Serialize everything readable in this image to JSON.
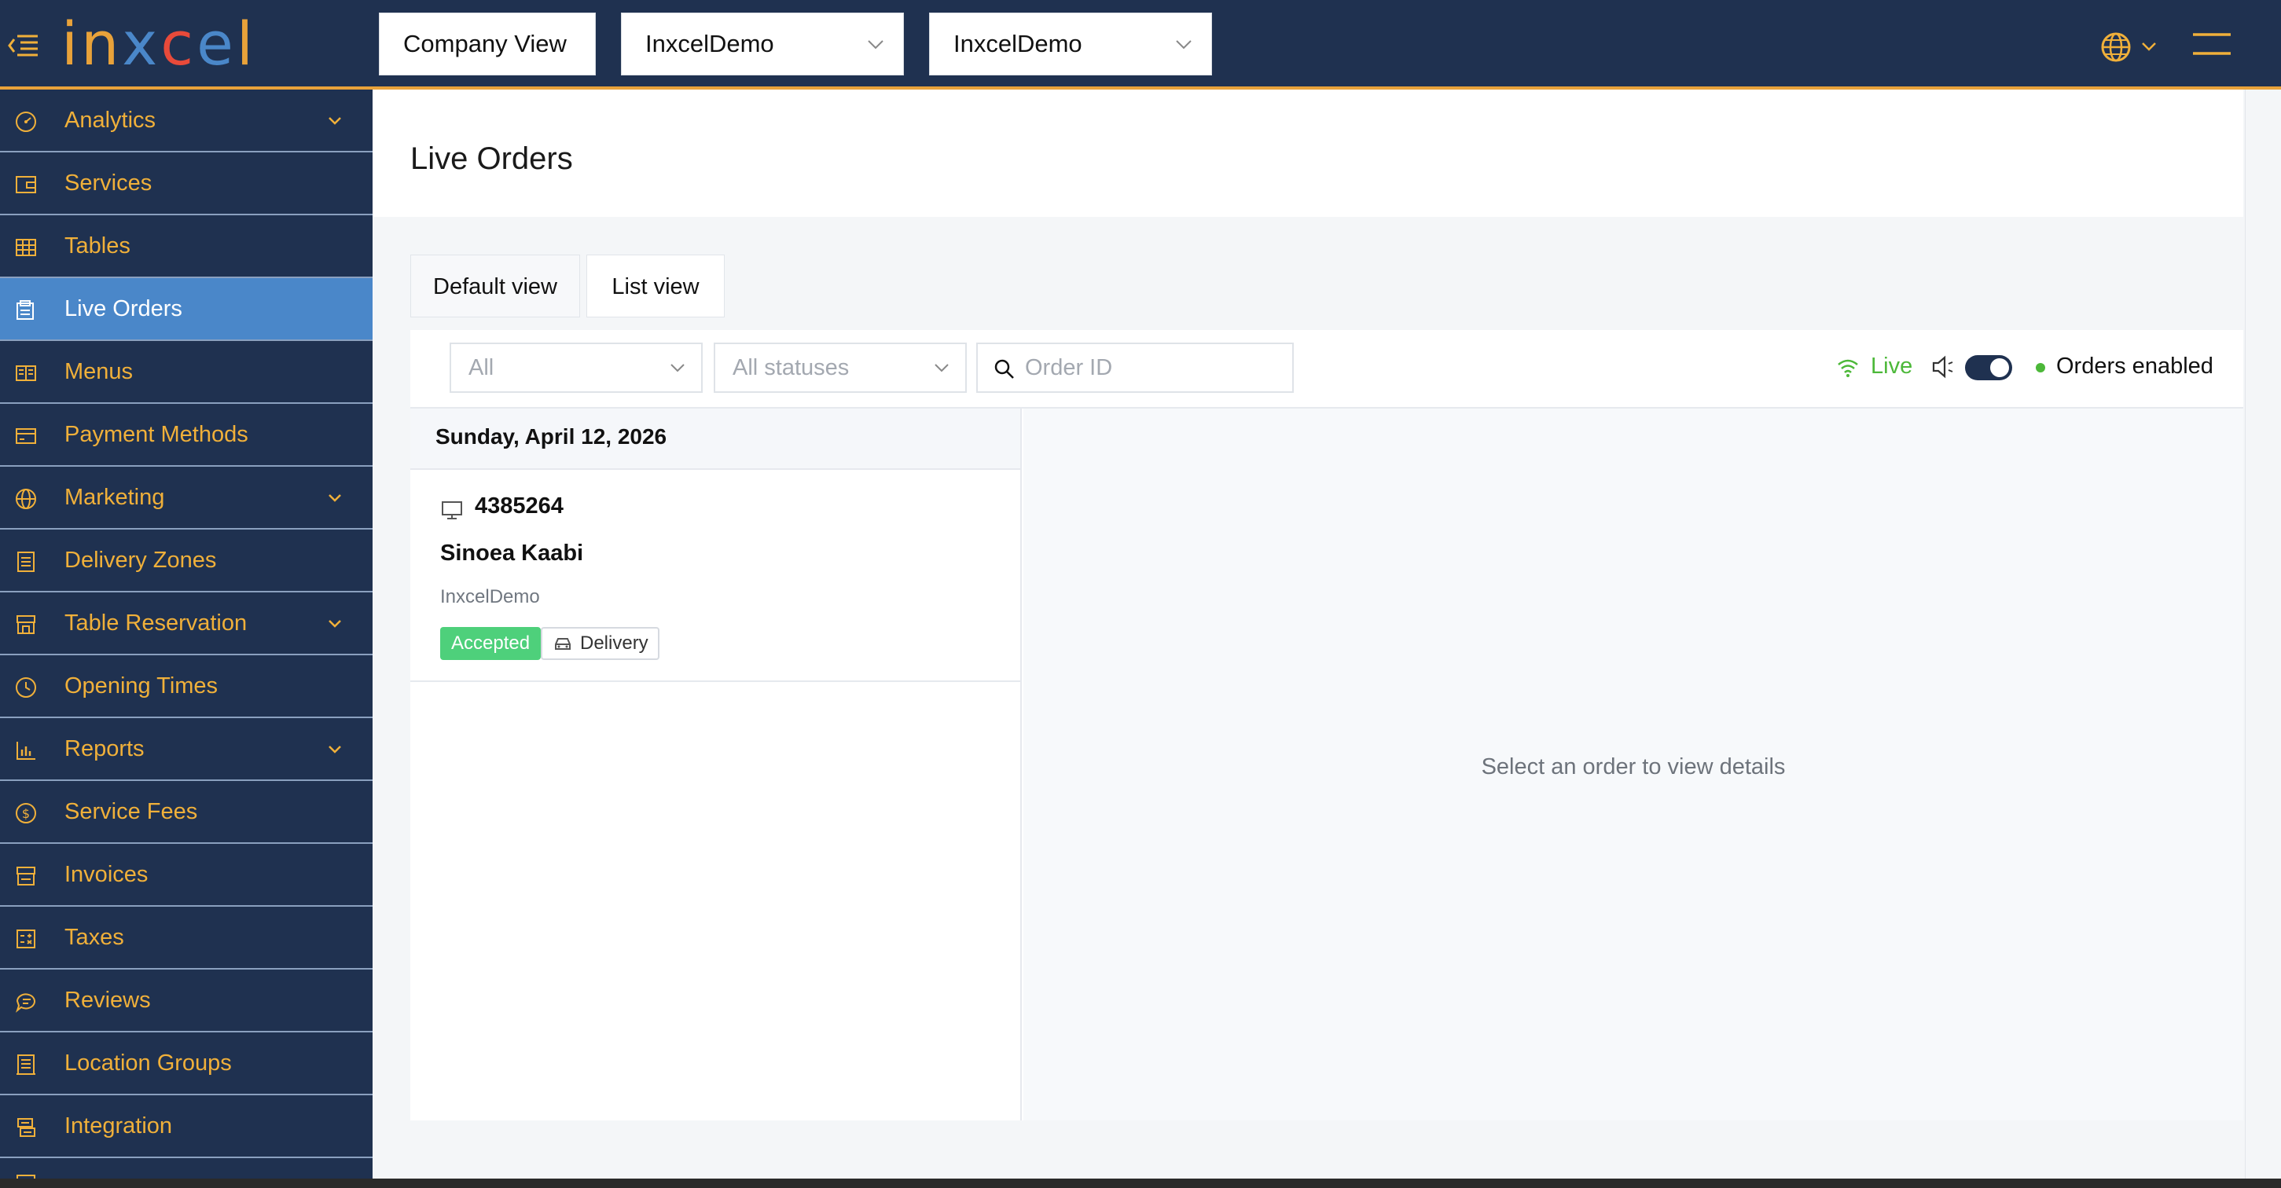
{
  "header": {
    "logo_text": "inxcel",
    "logo_colors": [
      "#e8a23a",
      "#e8a23a",
      "#4a87c9",
      "#e84a3a",
      "#4a87c9"
    ],
    "view_selector": "Company View",
    "company_selector": "InxcelDemo",
    "location_selector": "InxcelDemo"
  },
  "sidebar": {
    "items": [
      {
        "label": "Analytics",
        "icon": "gauge-icon",
        "has_submenu": true
      },
      {
        "label": "Services",
        "icon": "wallet-icon",
        "has_submenu": false
      },
      {
        "label": "Tables",
        "icon": "table-grid-icon",
        "has_submenu": false
      },
      {
        "label": "Live Orders",
        "icon": "live-orders-icon",
        "has_submenu": false,
        "active": true
      },
      {
        "label": "Menus",
        "icon": "book-icon",
        "has_submenu": false
      },
      {
        "label": "Payment Methods",
        "icon": "credit-card-icon",
        "has_submenu": false
      },
      {
        "label": "Marketing",
        "icon": "globe-icon",
        "has_submenu": true
      },
      {
        "label": "Delivery Zones",
        "icon": "list-doc-icon",
        "has_submenu": false
      },
      {
        "label": "Table Reservation",
        "icon": "storefront-icon",
        "has_submenu": true
      },
      {
        "label": "Opening Times",
        "icon": "clock-icon",
        "has_submenu": false
      },
      {
        "label": "Reports",
        "icon": "bar-chart-icon",
        "has_submenu": true
      },
      {
        "label": "Service Fees",
        "icon": "dollar-circle-icon",
        "has_submenu": false
      },
      {
        "label": "Invoices",
        "icon": "invoice-icon",
        "has_submenu": false
      },
      {
        "label": "Taxes",
        "icon": "calculator-icon",
        "has_submenu": false
      },
      {
        "label": "Reviews",
        "icon": "chat-icon",
        "has_submenu": false
      },
      {
        "label": "Location Groups",
        "icon": "building-icon",
        "has_submenu": false
      },
      {
        "label": "Integration",
        "icon": "integration-icon",
        "has_submenu": false
      }
    ]
  },
  "main": {
    "page_title": "Live Orders",
    "tabs": [
      {
        "label": "Default view"
      },
      {
        "label": "List view"
      }
    ],
    "filters": {
      "type_select": "All",
      "status_select": "All statuses",
      "search_placeholder": "Order ID"
    },
    "status": {
      "live_label": "Live",
      "sound_enabled": true,
      "orders_label": "Orders enabled"
    },
    "orders_list": {
      "date_header": "Sunday, April 12, 2026",
      "orders": [
        {
          "id": "4385264",
          "customer": "Sinoea Kaabi",
          "location": "InxcelDemo",
          "status": "Accepted",
          "type": "Delivery"
        }
      ]
    },
    "details_empty": "Select an order to view details"
  },
  "colors": {
    "navy": "#1f3150",
    "accent_orange": "#f0b03a",
    "active_blue": "#4a87c9",
    "live_green": "#4cb839",
    "accepted_green": "#4ed07b"
  }
}
